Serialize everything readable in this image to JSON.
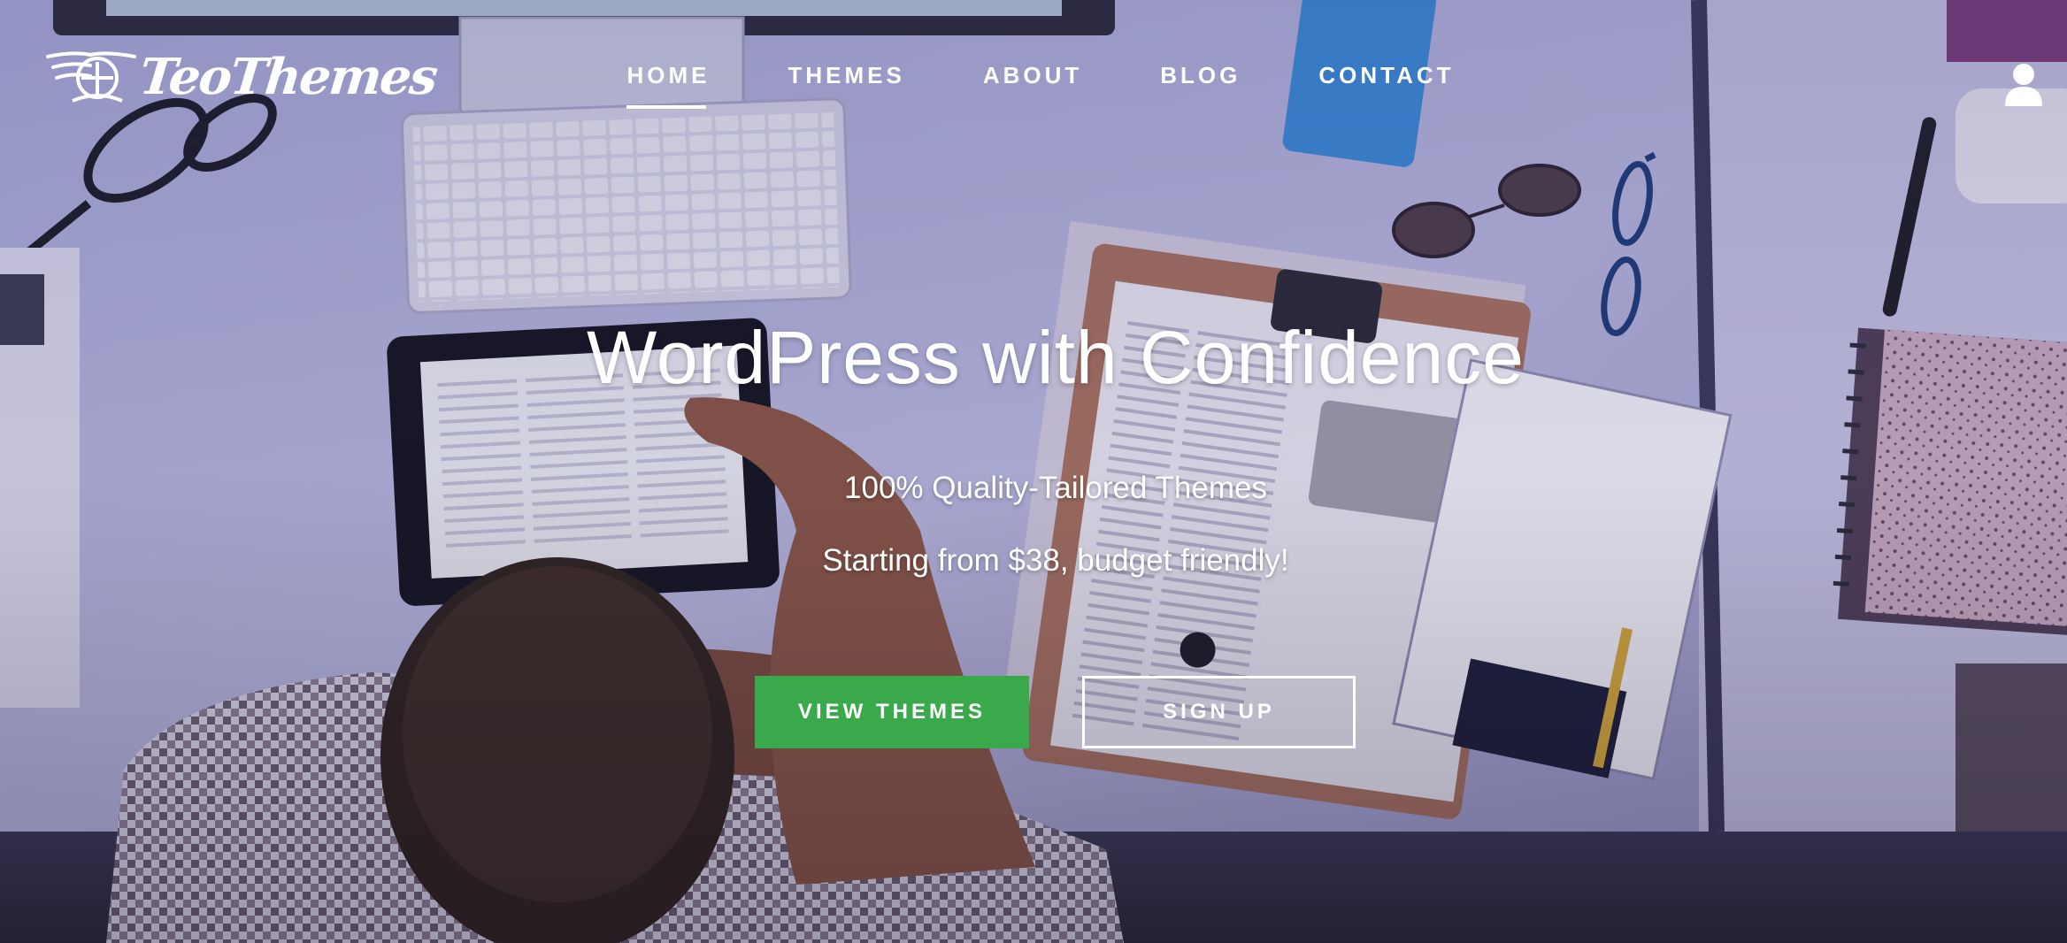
{
  "brand": {
    "logo_text": "TeoThemes"
  },
  "nav": {
    "items": [
      {
        "label": "HOME",
        "active": true
      },
      {
        "label": "THEMES",
        "active": false
      },
      {
        "label": "ABOUT",
        "active": false
      },
      {
        "label": "BLOG",
        "active": false
      },
      {
        "label": "CONTACT",
        "active": false
      }
    ]
  },
  "hero": {
    "headline": "WordPress with Confidence",
    "subheadline_1": "100% Quality-Tailored Themes",
    "subheadline_2": "Starting from $38, budget friendly!",
    "primary_button": "VIEW THEMES",
    "secondary_button": "SIGN UP"
  },
  "icons": {
    "account": "user-icon",
    "logo": "propeller-logo-icon"
  },
  "colors": {
    "primary_button": "#39a94c",
    "text": "#ffffff",
    "overlay_tint": "#6f74a8"
  }
}
